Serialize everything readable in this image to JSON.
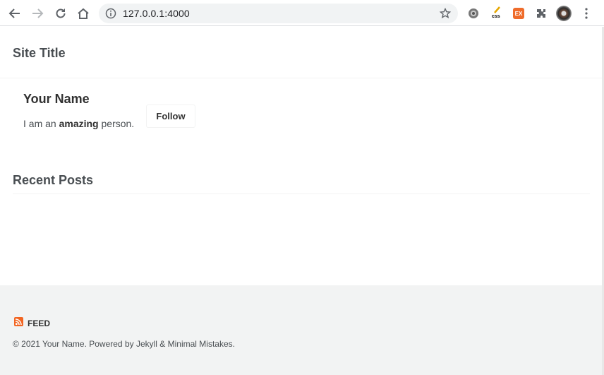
{
  "browser": {
    "url": "127.0.0.1:4000",
    "icons": [
      "back-icon",
      "forward-icon",
      "reload-icon",
      "home-icon",
      "info-icon",
      "bookmark-star-icon",
      "extensions-icon",
      "menu-icon"
    ],
    "ext_ex_label": "EX",
    "ext_css_label": "css"
  },
  "masthead": {
    "site_title": "Site Title"
  },
  "author": {
    "name": "Your Name",
    "bio_prefix": "I am an ",
    "bio_bold": "amazing",
    "bio_suffix": " person.",
    "follow_label": "Follow"
  },
  "recent": {
    "title": "Recent Posts"
  },
  "footer": {
    "feed_label": "FEED",
    "copyright": "© 2021 Your Name. Powered by Jekyll & Minimal Mistakes."
  },
  "colors": {
    "feed_icon": "#f26522",
    "footer_bg": "#f2f3f3",
    "text": "#494e52"
  }
}
